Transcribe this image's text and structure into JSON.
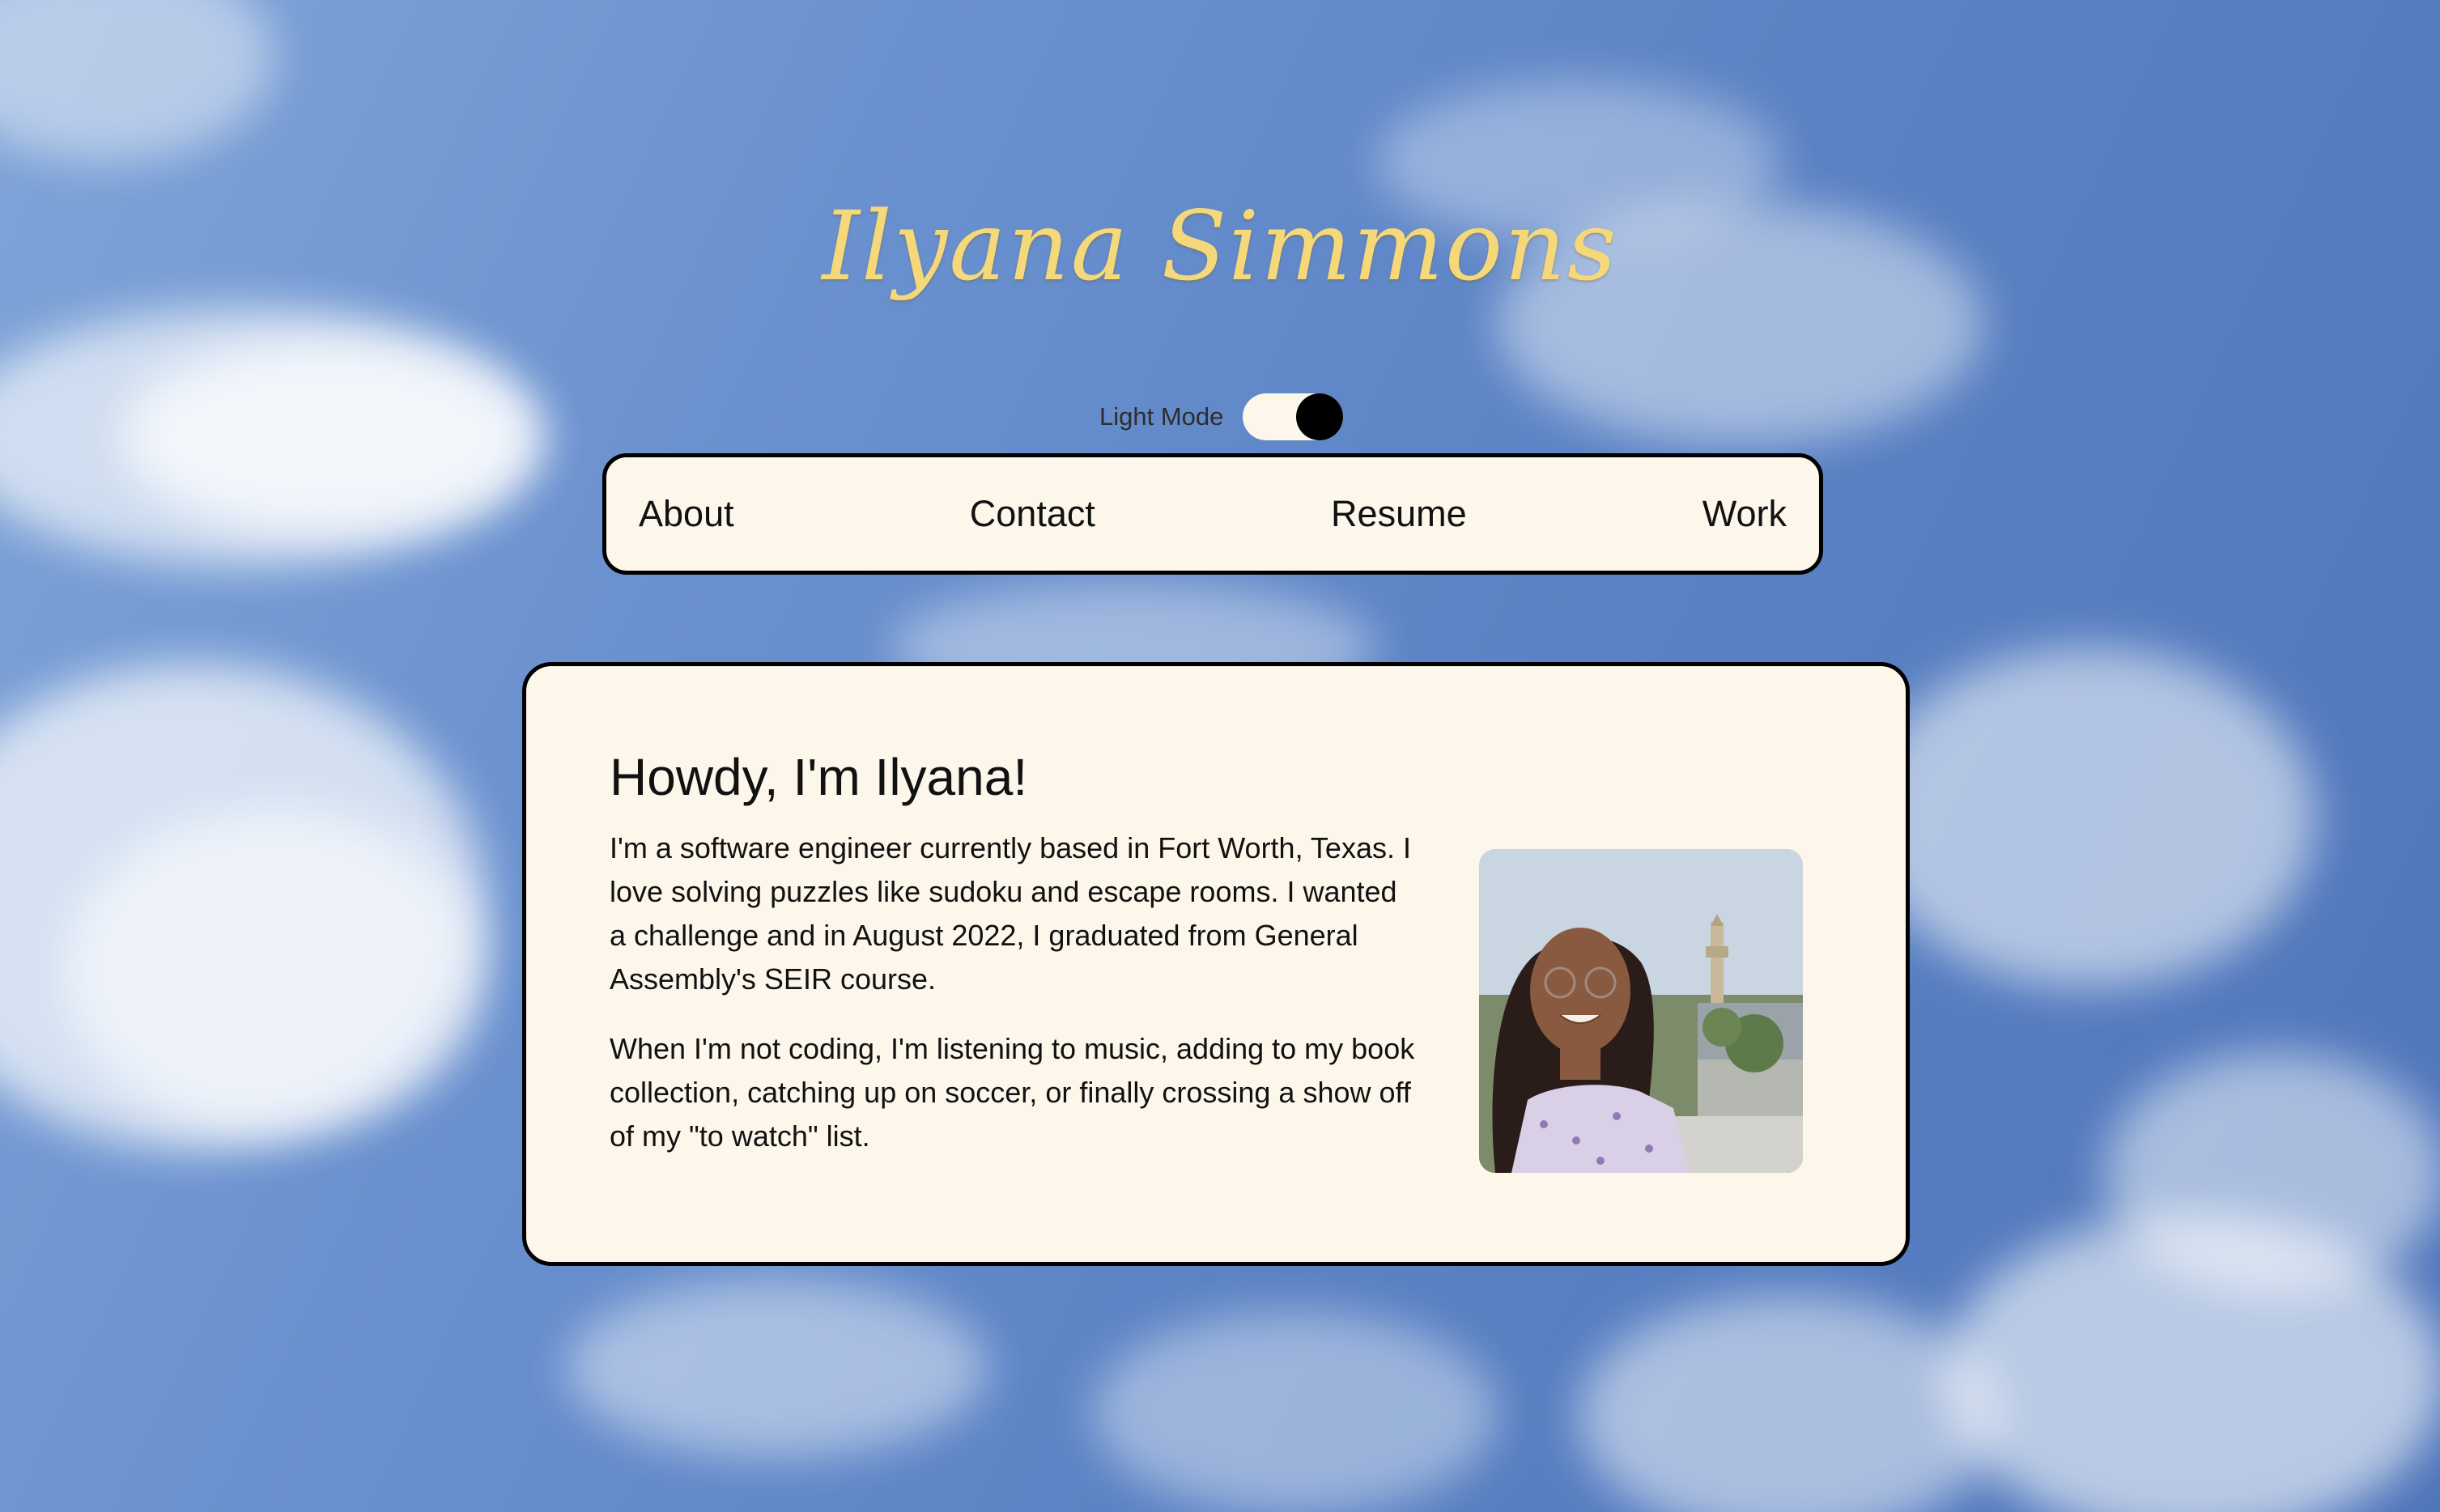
{
  "header": {
    "site_title": "Ilyana Simmons"
  },
  "theme_toggle": {
    "label": "Light Mode",
    "state": "on"
  },
  "nav": {
    "items": [
      {
        "label": "About"
      },
      {
        "label": "Contact"
      },
      {
        "label": "Resume"
      },
      {
        "label": "Work"
      }
    ]
  },
  "about": {
    "heading": "Howdy, I'm Ilyana!",
    "paragraph_1": "I'm a software engineer currently based in Fort Worth, Texas. I love solving puzzles like sudoku and escape rooms. I wanted a challenge and in August 2022, I graduated from General Assembly's SEIR course.",
    "paragraph_2": "When I'm not coding, I'm listening to music, adding to my book collection, catching up on soccer, or finally crossing a show off of my \"to watch\" list."
  },
  "colors": {
    "title_gold": "#f5d87a",
    "panel_cream": "#fdf6ea",
    "border_black": "#000000",
    "sky_blue": "#5a82c4"
  }
}
